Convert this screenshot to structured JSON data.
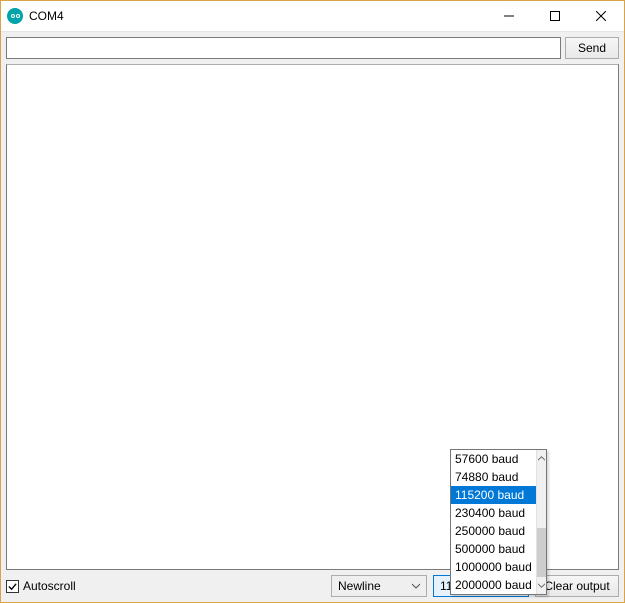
{
  "window": {
    "title": "COM4"
  },
  "toolbar": {
    "send_label": "Send",
    "input_value": ""
  },
  "bottom": {
    "autoscroll_label": "Autoscroll",
    "autoscroll_checked": true,
    "line_ending_selected": "Newline",
    "baud_selected": "115200 baud",
    "clear_label": "Clear output"
  },
  "baud_dropdown": {
    "visible_options": [
      "57600 baud",
      "74880 baud",
      "115200 baud",
      "230400 baud",
      "250000 baud",
      "500000 baud",
      "1000000 baud",
      "2000000 baud"
    ],
    "highlighted": "115200 baud"
  },
  "chart_data": null
}
